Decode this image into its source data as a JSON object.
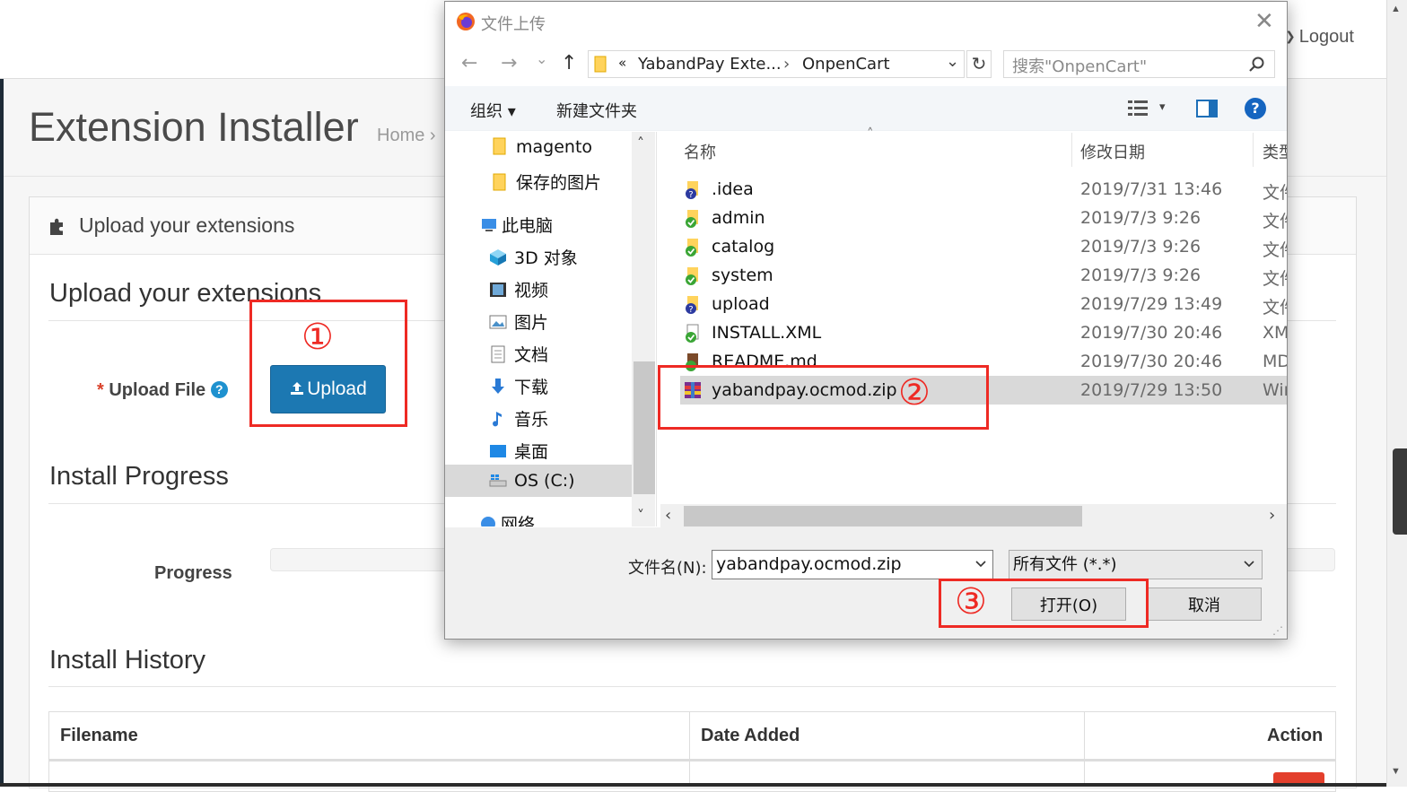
{
  "page": {
    "logout_label": "Logout",
    "title": "Extension Installer",
    "breadcrumb": "Home  ›",
    "panel_heading": "Upload your extensions",
    "section_upload": "Upload your extensions",
    "upload_file_label": "Upload File",
    "required_mark": "*",
    "help_glyph": "?",
    "upload_button": "Upload",
    "section_progress": "Install Progress",
    "progress_label": "Progress",
    "progress_value": 0,
    "section_history": "Install History",
    "history_columns": [
      "Filename",
      "Date Added",
      "Action"
    ]
  },
  "annotations": {
    "step1": "①",
    "step2": "②",
    "step3": "③",
    "color": "#ee2a24"
  },
  "dialog": {
    "title": "文件上传",
    "close_glyph": "✕",
    "nav": {
      "back": "←",
      "forward": "→",
      "recent": "⌄",
      "up": "↑"
    },
    "address": {
      "prefix": "«",
      "crumb1": "YabandPay Exte...",
      "sep": "›",
      "crumb2": "OnpenCart",
      "dropdown": "⌄"
    },
    "refresh_glyph": "↻",
    "search_placeholder": "搜索\"OnpenCart\"",
    "search_icon": "search-icon",
    "toolbar": {
      "organize": "组织 ▾",
      "new_folder": "新建文件夹",
      "view_arrow": "▾",
      "help": "?"
    },
    "nav_tree": [
      {
        "label": "magento",
        "icon": "folder-icon"
      },
      {
        "label": "保存的图片",
        "icon": "folder-icon"
      },
      {
        "label": "此电脑",
        "icon": "computer-icon"
      },
      {
        "label": "3D 对象",
        "icon": "cube-icon"
      },
      {
        "label": "视频",
        "icon": "video-icon"
      },
      {
        "label": "图片",
        "icon": "pictures-icon"
      },
      {
        "label": "文档",
        "icon": "document-icon"
      },
      {
        "label": "下载",
        "icon": "download-icon"
      },
      {
        "label": "音乐",
        "icon": "music-icon"
      },
      {
        "label": "桌面",
        "icon": "desktop-icon"
      },
      {
        "label": "OS (C:)",
        "icon": "drive-icon"
      },
      {
        "label": "网络",
        "icon": "network-icon"
      }
    ],
    "columns": {
      "name": "名称",
      "date": "修改日期",
      "type": "类型",
      "sort_arrow": "˄"
    },
    "files": [
      {
        "name": ".idea",
        "date": "2019/7/31 13:46",
        "type": "文件",
        "status": "unknown"
      },
      {
        "name": "admin",
        "date": "2019/7/3 9:26",
        "type": "文件",
        "status": "synced"
      },
      {
        "name": "catalog",
        "date": "2019/7/3 9:26",
        "type": "文件",
        "status": "synced"
      },
      {
        "name": "system",
        "date": "2019/7/3 9:26",
        "type": "文件",
        "status": "synced"
      },
      {
        "name": "upload",
        "date": "2019/7/29 13:49",
        "type": "文件",
        "status": "unknown"
      },
      {
        "name": "INSTALL.XML",
        "date": "2019/7/30 20:46",
        "type": "XM",
        "status": "synced"
      },
      {
        "name": "README.md",
        "date": "2019/7/30 20:46",
        "type": "MD",
        "status": "synced"
      },
      {
        "name": "yabandpay.ocmod.zip",
        "date": "2019/7/29 13:50",
        "type": "Wir",
        "status": "selected"
      }
    ],
    "scroll": {
      "left": "‹",
      "right": "›",
      "up": "˄",
      "down": "˅"
    },
    "filename_label": "文件名(N):",
    "filename_value": "yabandpay.ocmod.zip",
    "filetype_value": "所有文件 (*.*)",
    "open_button": "打开(O)",
    "cancel_button": "取消",
    "grip": "⋰"
  }
}
